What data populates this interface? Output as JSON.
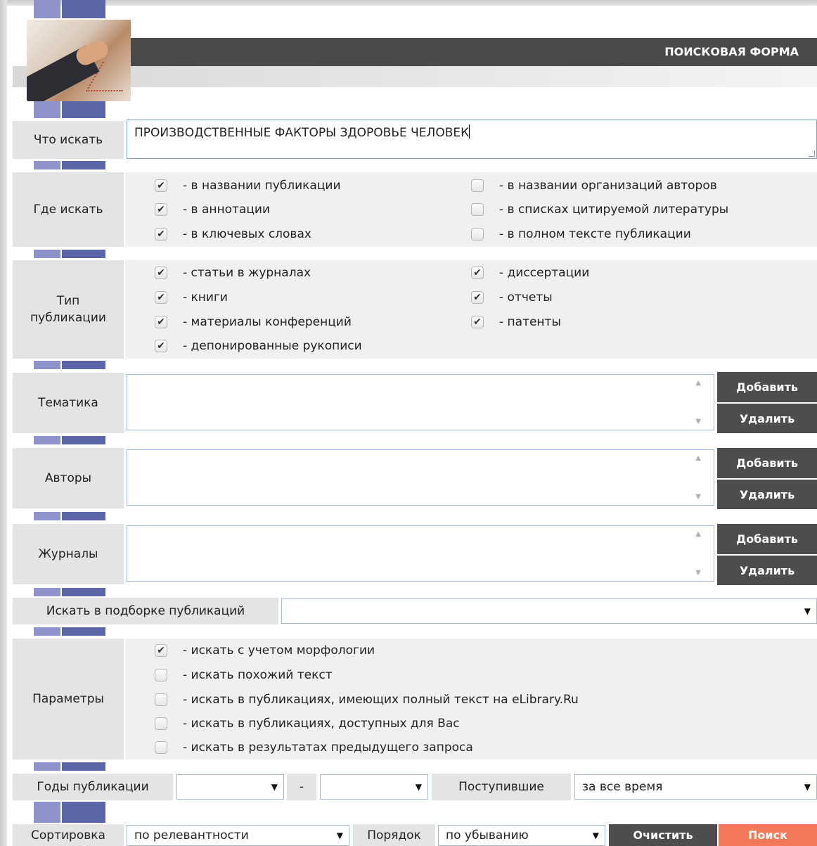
{
  "header": {
    "title": "ПОИСКОВАЯ ФОРМА"
  },
  "query": {
    "label": "Что искать",
    "value": "ПРОИЗВОДСТВЕННЫЕ ФАКТОРЫ ЗДОРОВЬЕ ЧЕЛОВЕК"
  },
  "where": {
    "label": "Где искать",
    "left": [
      {
        "label": "- в названии публикации",
        "checked": true
      },
      {
        "label": "- в аннотации",
        "checked": true
      },
      {
        "label": "- в ключевых словах",
        "checked": true
      }
    ],
    "right": [
      {
        "label": "- в названии организаций авторов",
        "checked": false
      },
      {
        "label": "- в списках цитируемой литературы",
        "checked": false
      },
      {
        "label": "- в полном тексте публикации",
        "checked": false
      }
    ]
  },
  "pubtype": {
    "label_line1": "Тип",
    "label_line2": "публикации",
    "left": [
      {
        "label": "- статьи в журналах",
        "checked": true
      },
      {
        "label": "- книги",
        "checked": true
      },
      {
        "label": "- материалы конференций",
        "checked": true
      },
      {
        "label": "- депонированные рукописи",
        "checked": true
      }
    ],
    "right": [
      {
        "label": "- диссертации",
        "checked": true
      },
      {
        "label": "- отчеты",
        "checked": true
      },
      {
        "label": "- патенты",
        "checked": true
      }
    ]
  },
  "lists": {
    "topic": {
      "label": "Тематика",
      "add": "Добавить",
      "remove": "Удалить"
    },
    "authors": {
      "label": "Авторы",
      "add": "Добавить",
      "remove": "Удалить"
    },
    "journals": {
      "label": "Журналы",
      "add": "Добавить",
      "remove": "Удалить"
    }
  },
  "collection": {
    "label": "Искать в подборке публикаций",
    "value": ""
  },
  "params": {
    "label": "Параметры",
    "items": [
      {
        "label": "- искать с учетом морфологии",
        "checked": true
      },
      {
        "label": "- искать похожий текст",
        "checked": false
      },
      {
        "label": "- искать в публикациях, имеющих полный текст на eLibrary.Ru",
        "checked": false
      },
      {
        "label": "- искать в публикациях, доступных для Вас",
        "checked": false
      },
      {
        "label": "- искать в результатах предыдущего запроса",
        "checked": false
      }
    ]
  },
  "years": {
    "label": "Годы публикации",
    "from": "",
    "dash": "-",
    "to": "",
    "received_label": "Поступившие",
    "received_value": "за все время"
  },
  "sort": {
    "label": "Сортировка",
    "value": "по релевантности",
    "order_label": "Порядок",
    "order_value": "по убыванию",
    "clear": "Очистить",
    "search": "Поиск"
  }
}
